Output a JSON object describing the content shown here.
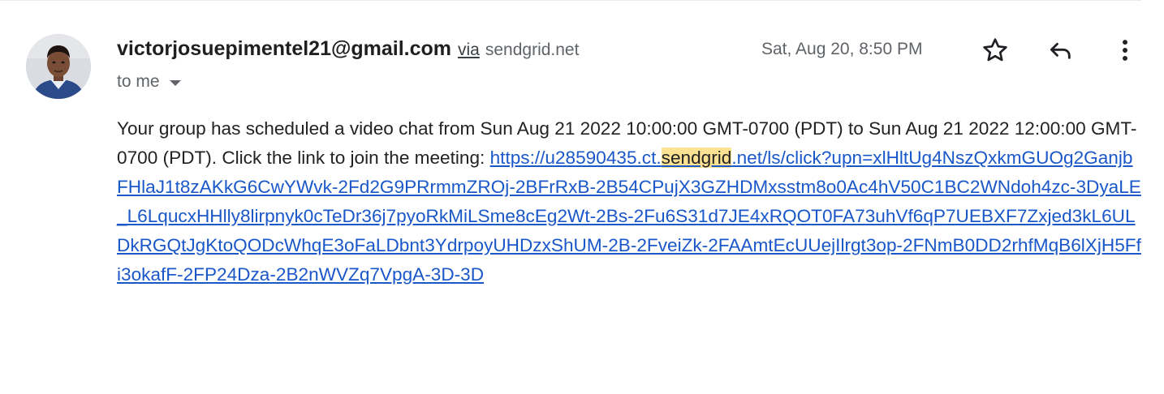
{
  "sender": {
    "email": "victorjosuepimentel21@gmail.com",
    "via_word": "via",
    "via_domain": "sendgrid.net"
  },
  "recipient": {
    "label": "to me"
  },
  "timestamp": "Sat, Aug 20, 8:50 PM",
  "icons": {
    "star": "star-icon",
    "reply": "reply-icon",
    "more": "more-vert-icon",
    "dropdown": "chevron-down-icon"
  },
  "message": {
    "intro_text": "Your group has scheduled a video chat from Sun Aug 21 2022 10:00:00 GMT-0700 (PDT) to Sun Aug 21 2022 12:00:00 GMT-0700 (PDT). Click the link to join the meeting: ",
    "link_before_highlight": "https://u28590435.ct.",
    "link_highlight": "sendgrid",
    "link_after_highlight": ".net/ls/click?upn=xlHltUg4NszQxkmGUOg2GanjbFHlaJ1t8zAKkG6CwYWvk-2Fd2G9PRrmmZROj-2BFrRxB-2B54CPujX3GZHDMxsstm8o0Ac4hV50C1BC2WNdoh4zc-3DyaLE_L6LqucxHHlly8lirpnyk0cTeDr36j7pyoRkMiLSme8cEg2Wt-2Bs-2Fu6S31d7JE4xRQOT0FA73uhVf6qP7UEBXF7Zxjed3kL6ULDkRGQtJgKtoQODcWhqE3oFaLDbnt3YdrpoyUHDzxShUM-2B-2FveiZk-2FAAmtEcUUejIlrgt3op-2FNmB0DD2rhfMqB6lXjH5Ffi3okafF-2FP24Dza-2B2nWVZq7VpgA-3D-3D"
  },
  "colors": {
    "link": "#1a57c9",
    "highlight": "#fde293",
    "secondary_text": "#5f6368"
  }
}
